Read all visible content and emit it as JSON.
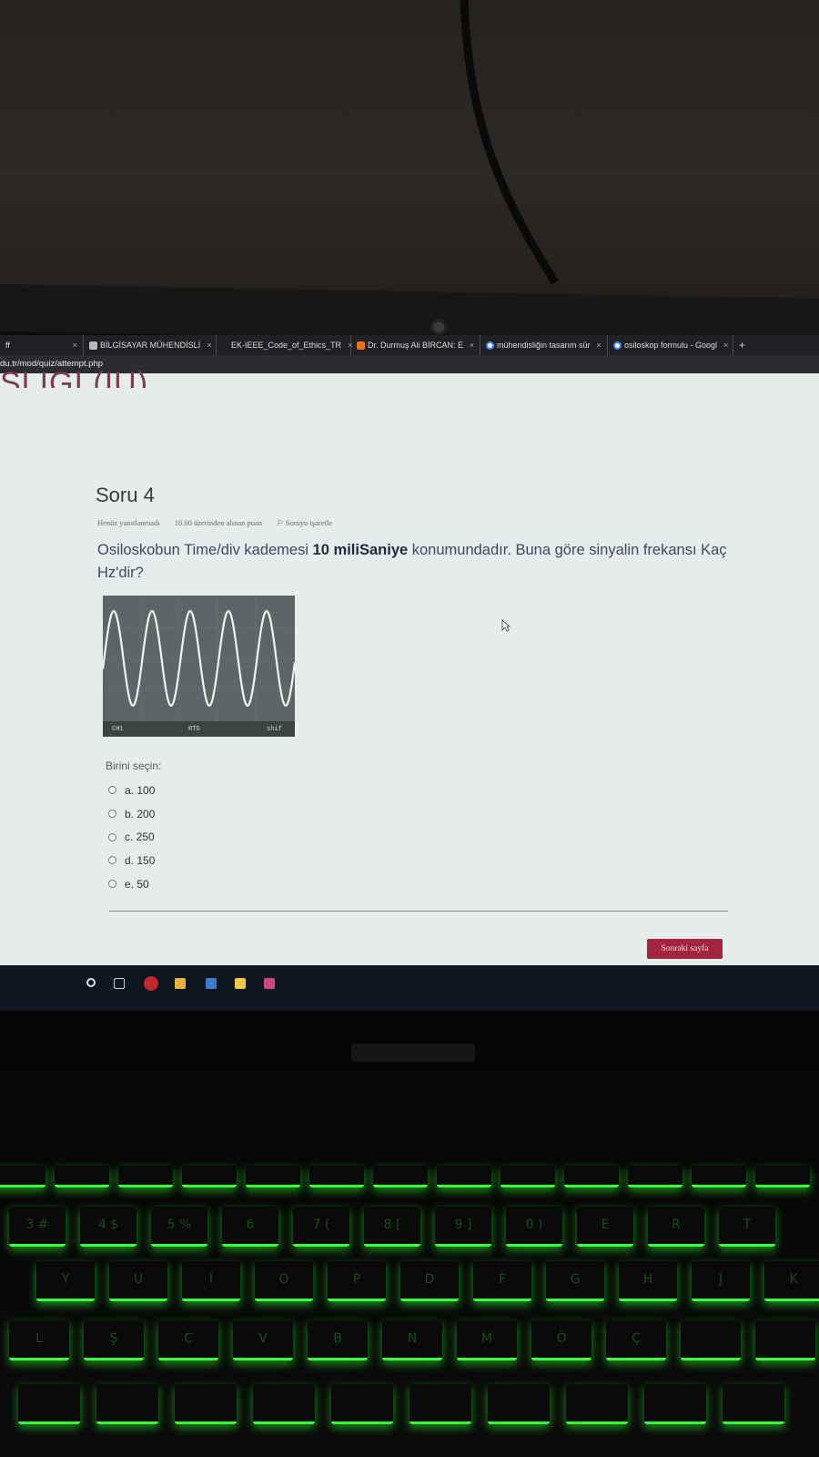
{
  "browser": {
    "tabs": [
      {
        "label": "ff",
        "favicon": "none"
      },
      {
        "label": "BİLGİSAYAR MÜHENDİSLİ",
        "favicon": "document-icon"
      },
      {
        "label": "EK-IEEE_Code_of_Ethics_TR",
        "favicon": "none"
      },
      {
        "label": "Dr. Durmuş Ali BİRCAN: E",
        "favicon": "blogger-icon"
      },
      {
        "label": "mühendisliğin tasarım sür",
        "favicon": "google-icon"
      },
      {
        "label": "osiloskop formulu - Googl",
        "favicon": "google-icon"
      }
    ],
    "new_tab": "+",
    "close": "×",
    "url": "du.tr/mod/quiz/attempt.php"
  },
  "page": {
    "course_heading_fragment": "SLIGI (IU)",
    "question_title": "Soru 4",
    "meta": {
      "status": "Henüz yanıtlanmadı",
      "points": "10.00 üzerinden alınan puan",
      "flag": "Soruyu işaretle"
    },
    "question_text": {
      "part1": "Osiloskobun Time/div kademesi ",
      "bold": "10 miliSaniye",
      "part2": " konumundadır. Buna göre sinyalin frekansı Kaç Hz'dir?"
    },
    "scope_image": {
      "ch_label": "CH1",
      "trig_label": "RTG",
      "shift_label": "shif"
    },
    "choose_label": "Birini seçin:",
    "answers": [
      {
        "label": "a. 100"
      },
      {
        "label": "b. 200"
      },
      {
        "label": "c. 250"
      },
      {
        "label": "d. 150"
      },
      {
        "label": "e. 50"
      }
    ],
    "next_button": "Sonraki sayfa"
  },
  "keyboard": {
    "legends": [
      "3 #",
      "4 $",
      "5 %",
      "6",
      "7 (",
      "8 [",
      "9 ]",
      "0 )",
      "E",
      "R",
      "T",
      "Y",
      "U",
      "I",
      "O",
      "P",
      "D",
      "F",
      "G",
      "H",
      "J",
      "K",
      "L",
      "Ş",
      "C",
      "V",
      "B",
      "N",
      "M",
      "Ö",
      "Ç"
    ]
  },
  "colors": {
    "accent": "#a3243f",
    "page_bg": "#e6ebec",
    "keyboard_glow": "#3cff3c"
  }
}
